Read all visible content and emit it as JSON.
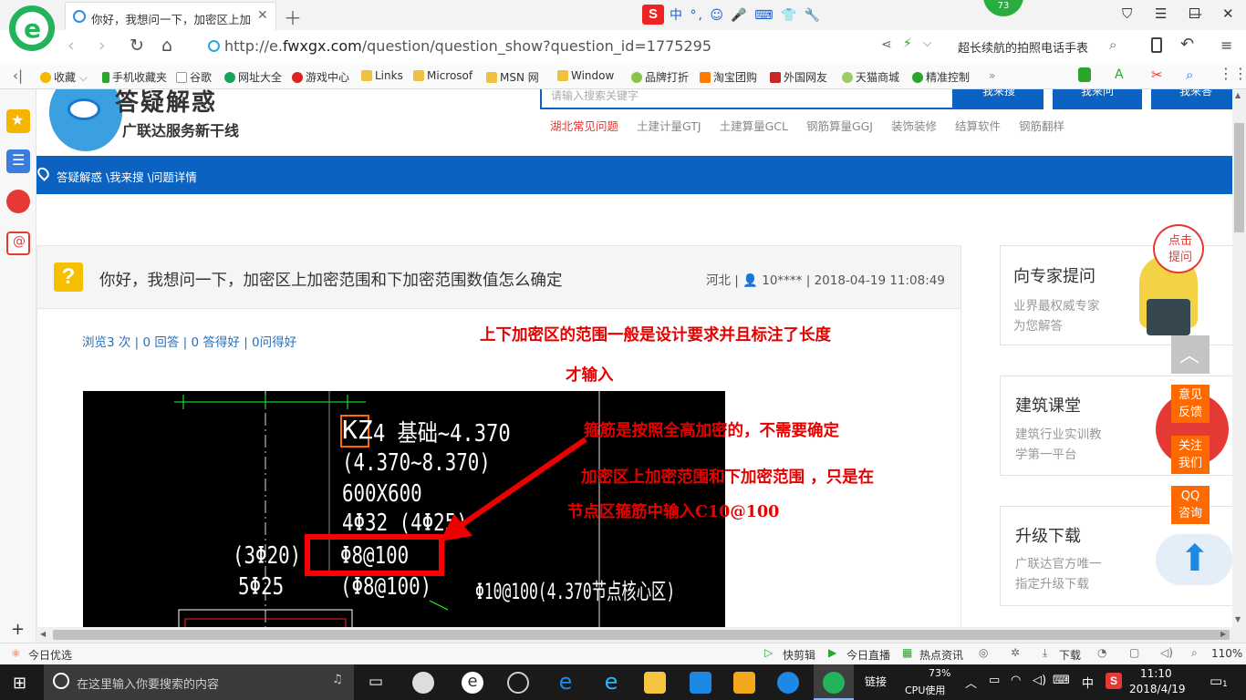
{
  "browser": {
    "tab_title": "你好，我想问一下，加密区上加密",
    "new_tab_icon": "plus-icon",
    "url_prefix": "http://e.",
    "url_domain": "fwxgx.com",
    "url_path": "/question/question_show?question_id=1775295",
    "search_text": "超长续航的拍照电话手表",
    "badge_number": "73",
    "ime_zh": "中",
    "ime_symbols": "°, ☺ 🎤 ⌨ 👕 🔧",
    "bookmarks": [
      "收藏",
      "手机收藏夹",
      "谷歌",
      "网址大全",
      "游戏中心",
      "Links",
      "Microsof",
      "MSN 网",
      "Window",
      "品牌打折",
      "淘宝团购",
      "外国网友",
      "天猫商城",
      "精准控制"
    ],
    "bookmarks_more": "»"
  },
  "site": {
    "logo_title": "答疑解惑",
    "logo_subtitle": "广联达服务新干线",
    "search_placeholder": "请输入搜索关键字",
    "search_buttons": [
      "我来搜",
      "我来问",
      "我来答"
    ],
    "hot_links": [
      "湖北常见问题",
      "土建计量GTJ",
      "土建算量GCL",
      "钢筋算量GGJ",
      "装饰装修",
      "结算软件",
      "钢筋翻样"
    ],
    "breadcrumb": "答疑解惑 \\我来搜 \\问题详情"
  },
  "question": {
    "title": "你好，我想问一下，加密区上加密范围和下加密范围数值怎么确定",
    "region": "河北",
    "user": "10****",
    "datetime": "2018-04-19 11:08:49",
    "stats": "浏览3 次 | 0 回答 | 0 答得好 | 0问得好",
    "annotation_1a": "上下加密区的范围一般是设计要求并且标注了长度",
    "annotation_1b": "才输入",
    "annotation_2": "箍筋是按照全高加密的，不需要确定",
    "annotation_3a": "加密区上加密范围和下加密范围 ，只是在",
    "annotation_3b": "节点区箍筋中输入C10@100",
    "cad": {
      "kz": "KZ",
      "kz_rest": "4  基础~4.370",
      "line2": "(4.370~8.370)",
      "line3": "600X600",
      "line4": "4Φ32  (4Φ25)",
      "left1": "(3Φ20)",
      "left2": "5Φ25",
      "boxed": "Φ8@100",
      "line6": "(Φ8@100)",
      "line6b": "Φ10@100(4.370节点核心区)"
    }
  },
  "right": {
    "cards": [
      {
        "title": "向专家提问",
        "desc1": "业界最权威专家",
        "desc2": "为您解答"
      },
      {
        "title": "建筑课堂",
        "desc1": "建筑行业实训教",
        "desc2": "学第一平台"
      },
      {
        "title": "升级下载",
        "desc1": "广联达官方唯一",
        "desc2": "指定升级下载"
      }
    ],
    "mascot_bubble": "点击提问",
    "float_buttons": [
      "意见反馈",
      "关注我们",
      "QQ咨询"
    ]
  },
  "statusbar": {
    "left": "今日优选",
    "items": [
      "快剪辑",
      "今日直播",
      "热点资讯"
    ],
    "download": "下载",
    "zoom": "110%"
  },
  "taskbar": {
    "search_placeholder": "在这里输入你要搜索的内容",
    "link_label": "链接",
    "cpu_percent": "73%",
    "cpu_label": "CPU使用",
    "ime": "中",
    "time": "11:10",
    "date": "2018/4/19",
    "notifications": "1"
  },
  "colors": {
    "site_blue": "#0b62c1",
    "accent_orange": "#ff6a00",
    "annotation_red": "#e60000",
    "browser_green": "#22b35b"
  }
}
